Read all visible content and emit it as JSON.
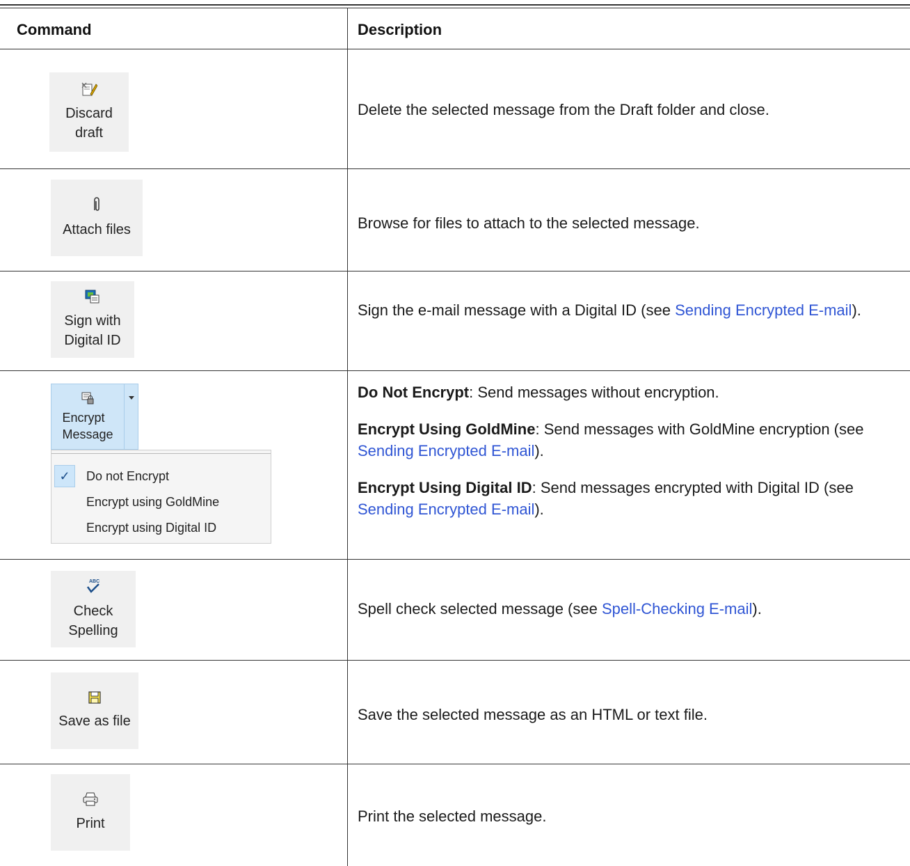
{
  "header": {
    "command": "Command",
    "description": "Description"
  },
  "rows": [
    {
      "button": {
        "label": "Discard\ndraft",
        "icon": "discard-draft-icon"
      },
      "desc": "Delete the selected message from the Draft folder and close."
    },
    {
      "button": {
        "label": "Attach files",
        "icon": "paperclip-icon"
      },
      "desc": "Browse for files to attach to the selected message."
    },
    {
      "button": {
        "label": "Sign with\nDigital ID",
        "icon": "digital-id-icon"
      },
      "desc_pre": "Sign the e-mail message with a Digital ID (see ",
      "desc_link": "Sending Encrypted E-mail",
      "desc_post": ")."
    },
    {
      "button": {
        "label": "Encrypt\nMessage",
        "icon": "encrypt-message-icon"
      },
      "menu": {
        "items": [
          "Do not Encrypt",
          "Encrypt using GoldMine",
          "Encrypt using Digital ID"
        ],
        "selected": "Do not Encrypt"
      },
      "desc1_bold": "Do Not Encrypt",
      "desc1": ": Send messages without encryption.",
      "desc2_bold": "Encrypt Using GoldMine",
      "desc2_pre": ": Send messages with GoldMine encryption (see ",
      "desc2_link": "Sending Encrypted E-mail",
      "desc2_post": ").",
      "desc3_bold": "Encrypt Using Digital ID",
      "desc3_pre": ": Send messages encrypted with Digital ID (see ",
      "desc3_link": "Sending Encrypted E-mail",
      "desc3_post": ")."
    },
    {
      "button": {
        "label": "Check\nSpelling",
        "icon": "spell-check-icon"
      },
      "desc_pre": "Spell check selected message (see ",
      "desc_link": "Spell-Checking E-mail",
      "desc_post": ")."
    },
    {
      "button": {
        "label": "Save as file",
        "icon": "floppy-disk-icon"
      },
      "desc": "Save the selected message as an HTML or text file."
    },
    {
      "button": {
        "label": "Print",
        "icon": "printer-icon"
      },
      "desc": "Print the selected message."
    }
  ],
  "colors": {
    "link": "#2f55d4",
    "button_bg": "#f0f0f0",
    "highlight": "#cfe6f8"
  }
}
